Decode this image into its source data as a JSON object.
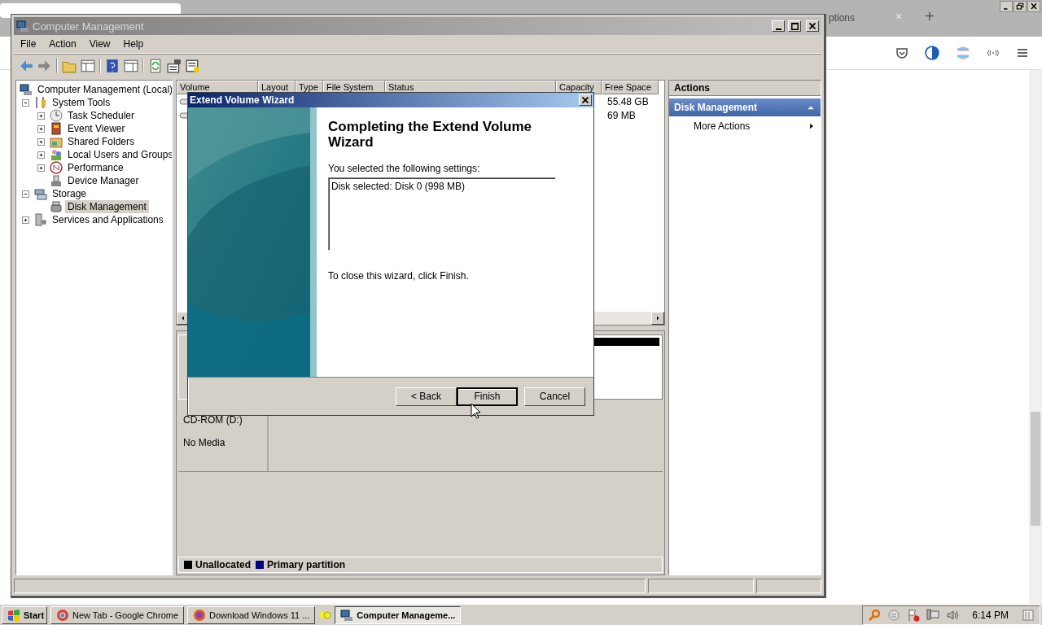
{
  "browser": {
    "tab_title": "ptions",
    "tab_close": "×",
    "new_tab": "+"
  },
  "window": {
    "title": "Computer Management"
  },
  "menu": [
    "File",
    "Action",
    "View",
    "Help"
  ],
  "tree": [
    {
      "label": "Computer Management (Local)",
      "selected": false,
      "children": [
        {
          "label": "System Tools",
          "expanded": true,
          "selected": false,
          "children": [
            {
              "label": "Task Scheduler",
              "expanded": false,
              "selected": false
            },
            {
              "label": "Event Viewer",
              "expanded": false,
              "selected": false
            },
            {
              "label": "Shared Folders",
              "expanded": false,
              "selected": false
            },
            {
              "label": "Local Users and Groups",
              "expanded": false,
              "selected": false
            },
            {
              "label": "Performance",
              "expanded": false,
              "selected": false
            },
            {
              "label": "Device Manager",
              "selected": false
            }
          ]
        },
        {
          "label": "Storage",
          "expanded": true,
          "selected": false,
          "children": [
            {
              "label": "Disk Management",
              "selected": true
            }
          ]
        },
        {
          "label": "Services and Applications",
          "expanded": false,
          "selected": false
        }
      ]
    }
  ],
  "volume_list": {
    "columns": [
      "Volume",
      "Layout",
      "Type",
      "File System",
      "Status",
      "Capacity",
      "Free Space"
    ],
    "rows": [
      {
        "free_space": "55.48 GB"
      },
      {
        "free_space": "69 MB"
      }
    ]
  },
  "cdrom": {
    "name": "CD-ROM (D:)",
    "status": "No Media"
  },
  "legend": [
    {
      "label": "Unallocated",
      "color": "#000000"
    },
    {
      "label": "Primary partition",
      "color": "#000080"
    }
  ],
  "actions": {
    "title": "Actions",
    "section": "Disk Management",
    "items": [
      "More Actions"
    ]
  },
  "wizard": {
    "title": "Extend Volume Wizard",
    "heading": "Completing the Extend Volume Wizard",
    "intro": "You selected the following settings:",
    "settings": "Disk selected: Disk 0 (998 MB)",
    "closing": "To close this wizard, click Finish.",
    "buttons": [
      {
        "label": "< Back",
        "default": false
      },
      {
        "label": "Finish",
        "default": true
      },
      {
        "label": "Cancel",
        "default": false
      }
    ]
  },
  "taskbar": {
    "start": "Start",
    "tasks": [
      {
        "label": "New Tab - Google Chrome",
        "selected": false
      },
      {
        "label": "Download Windows 11 ...",
        "selected": false
      },
      {
        "label": "Computer Manageme...",
        "selected": true
      }
    ],
    "clock": "6:14 PM"
  }
}
